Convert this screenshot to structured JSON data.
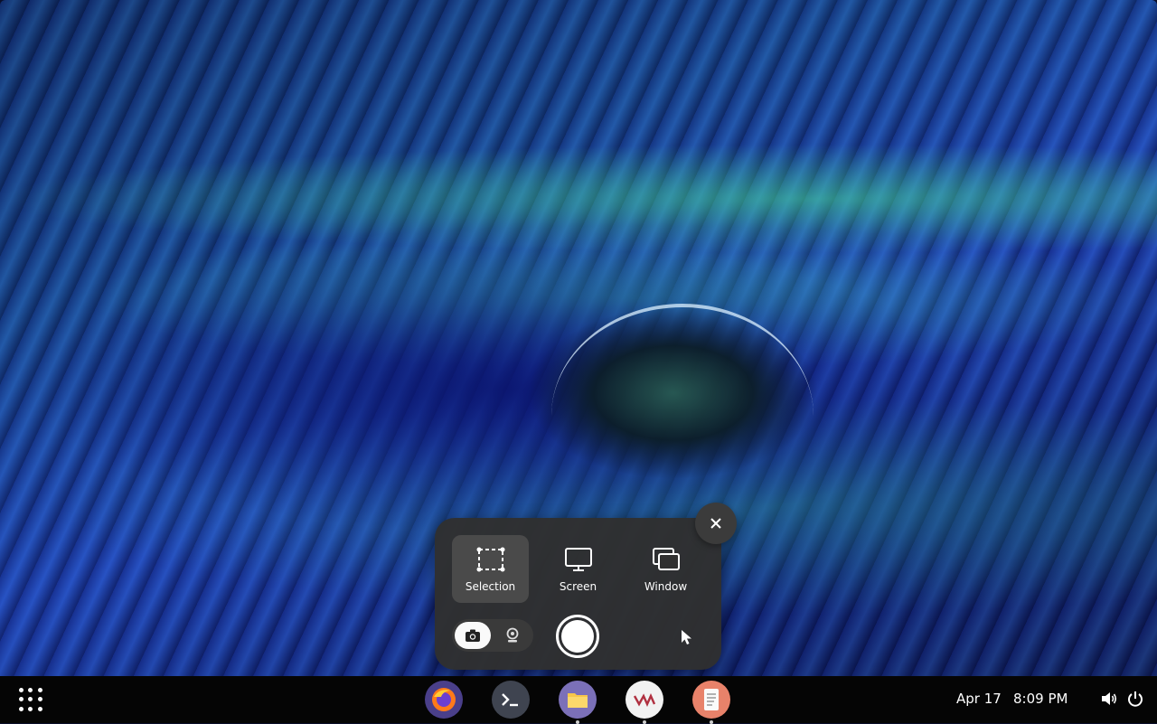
{
  "screenshot_ui": {
    "modes": [
      {
        "label": "Selection",
        "icon": "selection-icon",
        "active": true
      },
      {
        "label": "Screen",
        "icon": "monitor-icon",
        "active": false
      },
      {
        "label": "Window",
        "icon": "window-icon",
        "active": false
      }
    ],
    "capture_types": [
      {
        "icon": "camera-icon",
        "active": true
      },
      {
        "icon": "webcam-icon",
        "active": false
      }
    ],
    "close_icon": "close-icon",
    "capture_icon": "capture-circle-icon",
    "pointer_icon": "pointer-icon"
  },
  "taskbar": {
    "apps_icon": "app-grid-icon",
    "dock": [
      {
        "icon": "firefox-icon",
        "running": false,
        "color": "#5b4fa0"
      },
      {
        "icon": "terminal-icon",
        "running": false,
        "color": "#3f4450"
      },
      {
        "icon": "files-icon",
        "running": true,
        "color": "#7b70b8"
      },
      {
        "icon": "vm-icon",
        "running": true,
        "color": "#f2f2f2"
      },
      {
        "icon": "text-editor-icon",
        "running": true,
        "color": "#e8826a"
      }
    ],
    "date": "Apr 17",
    "time": "8:09 PM",
    "tray": [
      "volume-icon",
      "power-icon"
    ]
  },
  "colors": {
    "panel": "#303030",
    "active_mode": "#4a4a4a",
    "close_button": "#3b3b3b"
  }
}
